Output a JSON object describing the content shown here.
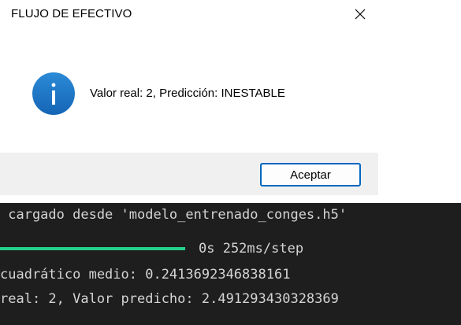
{
  "dialog": {
    "title": "FLUJO DE EFECTIVO",
    "icon": "info-icon",
    "message": "Valor real: 2, Predicción: INESTABLE",
    "ok_label": "Aceptar",
    "colors": {
      "accent": "#0067c0",
      "info_icon": "#1e78c8",
      "footer": "#f0f0f0"
    }
  },
  "terminal": {
    "line1": " cargado desde 'modelo_entrenado_conges.h5'",
    "progress": {
      "fraction": 1.0,
      "timing": "0s 252ms/step"
    },
    "line3": "cuadrático medio: 0.2413692346838161",
    "line4": "real: 2, Valor predicho: 2.491293430328369",
    "colors": {
      "background": "#1e1e1e",
      "text": "#d4d4d4",
      "progress": "#23d18b"
    }
  }
}
